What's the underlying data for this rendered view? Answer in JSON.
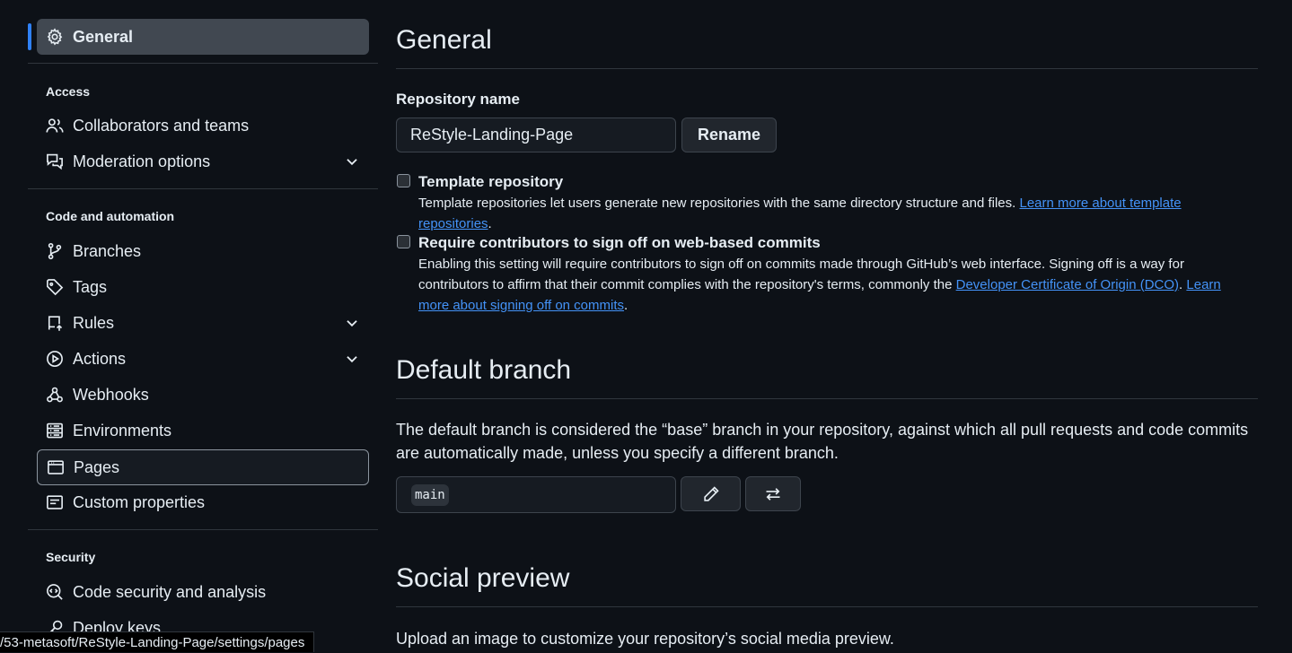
{
  "sidebar": {
    "items": {
      "general": "General",
      "collaborators": "Collaborators and teams",
      "moderation": "Moderation options",
      "branches": "Branches",
      "tags": "Tags",
      "rules": "Rules",
      "actions": "Actions",
      "webhooks": "Webhooks",
      "environments": "Environments",
      "pages": "Pages",
      "custom_properties": "Custom properties",
      "code_security": "Code security and analysis",
      "deploy_keys": "Deploy keys"
    },
    "sections": {
      "access": "Access",
      "code_automation": "Code and automation",
      "security": "Security"
    }
  },
  "main": {
    "general_title": "General",
    "repo_name_label": "Repository name",
    "repo_name_value": "ReStyle-Landing-Page",
    "rename_button": "Rename",
    "template": {
      "title": "Template repository",
      "desc": "Template repositories let users generate new repositories with the same directory structure and files. ",
      "link": "Learn more about template repositories",
      "checked": false
    },
    "signoff": {
      "title": "Require contributors to sign off on web-based commits",
      "desc_1": "Enabling this setting will require contributors to sign off on commits made through GitHub’s web interface. Signing off is a way for contributors to affirm that their commit complies with the repository's terms, commonly the ",
      "link_dco": "Developer Certificate of Origin (DCO)",
      "desc_2": ". ",
      "link_learn": "Learn more about signing off on commits",
      "desc_3": ".",
      "checked": false
    },
    "default_branch_title": "Default branch",
    "default_branch_desc": "The default branch is considered the “base” branch in your repository, against which all pull requests and code commits are automatically made, unless you specify a different branch.",
    "default_branch_value": "main",
    "social_preview_title": "Social preview",
    "social_preview_desc": "Upload an image to customize your repository’s social media preview."
  },
  "status_url": "/53-metasoft/ReStyle-Landing-Page/settings/pages",
  "colors": {
    "background": "#0d1117",
    "accent": "#2f81f7",
    "link": "#4493f8"
  }
}
